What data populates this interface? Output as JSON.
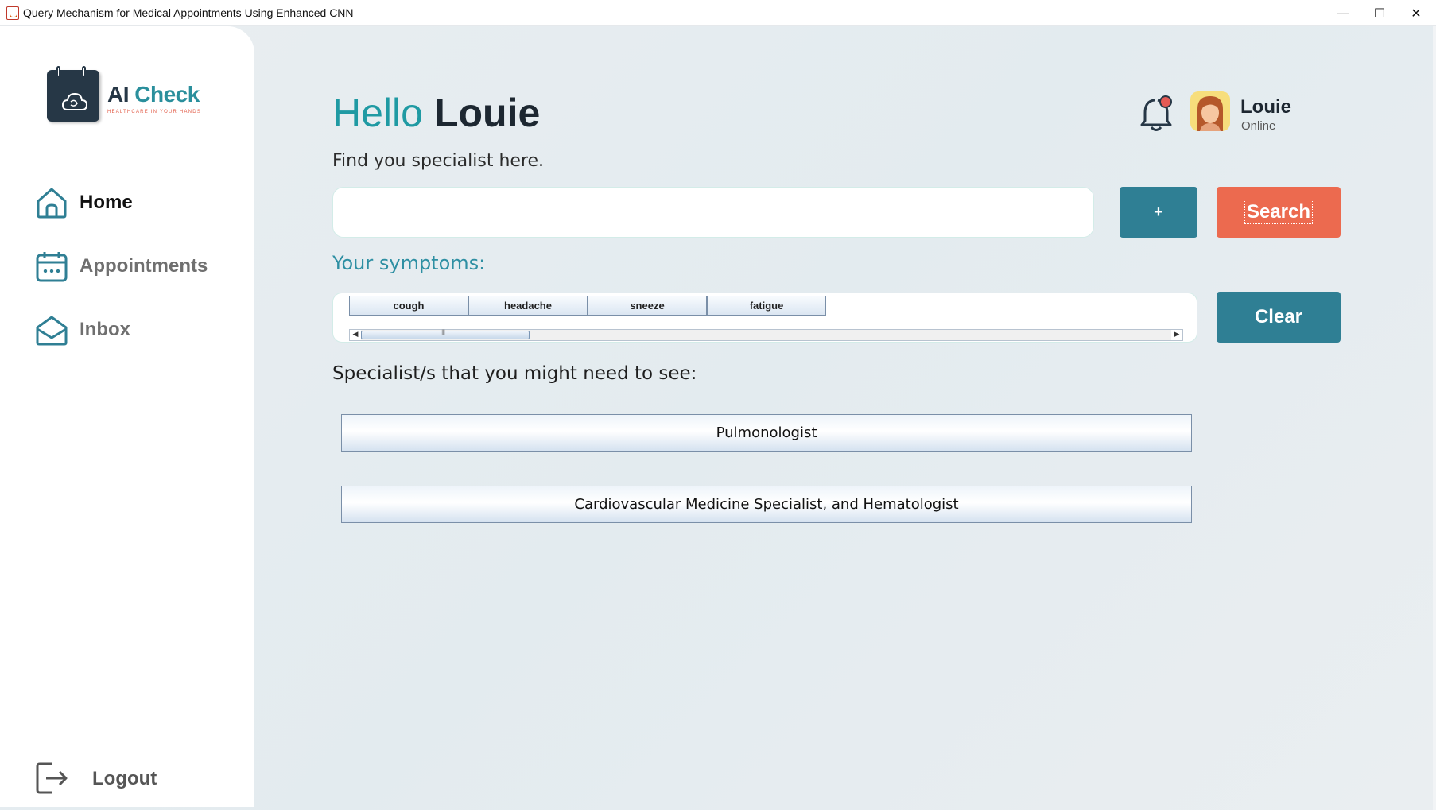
{
  "window": {
    "title": "Query Mechanism for Medical Appointments Using Enhanced CNN",
    "minimize_glyph": "—",
    "maximize_glyph": "☐",
    "close_glyph": "✕"
  },
  "brand": {
    "name_part1": "AI",
    "name_part2": "Check",
    "tagline": "HEALTHCARE IN YOUR HANDS"
  },
  "sidebar": {
    "items": [
      {
        "label": "Home",
        "icon": "home-icon",
        "active": true
      },
      {
        "label": "Appointments",
        "icon": "calendar-icon",
        "active": false
      },
      {
        "label": "Inbox",
        "icon": "mail-icon",
        "active": false
      }
    ],
    "logout_label": "Logout"
  },
  "header": {
    "hello": "Hello",
    "user_first_name": "Louie",
    "subtitle": "Find you specialist here."
  },
  "user": {
    "name": "Louie",
    "status": "Online",
    "has_notification": true
  },
  "search": {
    "value": "",
    "placeholder": "",
    "add_label": "+",
    "search_label": "Search"
  },
  "symptoms": {
    "label": "Your symptoms:",
    "items": [
      "cough",
      "headache",
      "sneeze",
      "fatigue"
    ],
    "clear_label": "Clear"
  },
  "specialists": {
    "heading": "Specialist/s that you might need to see:",
    "items": [
      "Pulmonologist",
      "Cardiovascular Medicine Specialist, and Hematologist"
    ]
  },
  "colors": {
    "teal": "#1f9aa3",
    "button_teal": "#2f7f94",
    "search_orange": "#ec6a4f",
    "navy": "#263746"
  }
}
